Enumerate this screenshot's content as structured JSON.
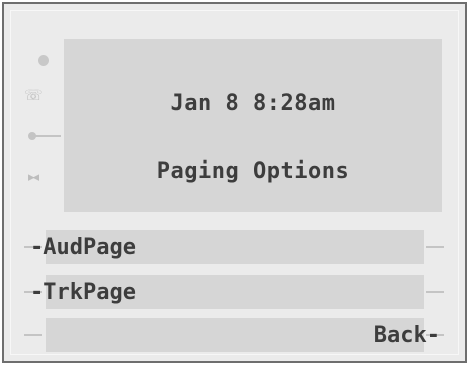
{
  "screen": {
    "datetime": "Jan 8 8:28am",
    "title": "Paging Options"
  },
  "softkeys": [
    {
      "label": "-AudPage",
      "side": "left"
    },
    {
      "label": "-TrkPage",
      "side": "left"
    },
    {
      "label": "Back-",
      "side": "right"
    }
  ],
  "side_icons": [
    "status-dot-icon",
    "handset-icon",
    "key-icon",
    "mute-icon"
  ],
  "colors": {
    "frame_bg": "#ebebeb",
    "screen_bg": "#d6d6d6",
    "text": "#3d3d3d",
    "border": "#6e6e6e"
  }
}
